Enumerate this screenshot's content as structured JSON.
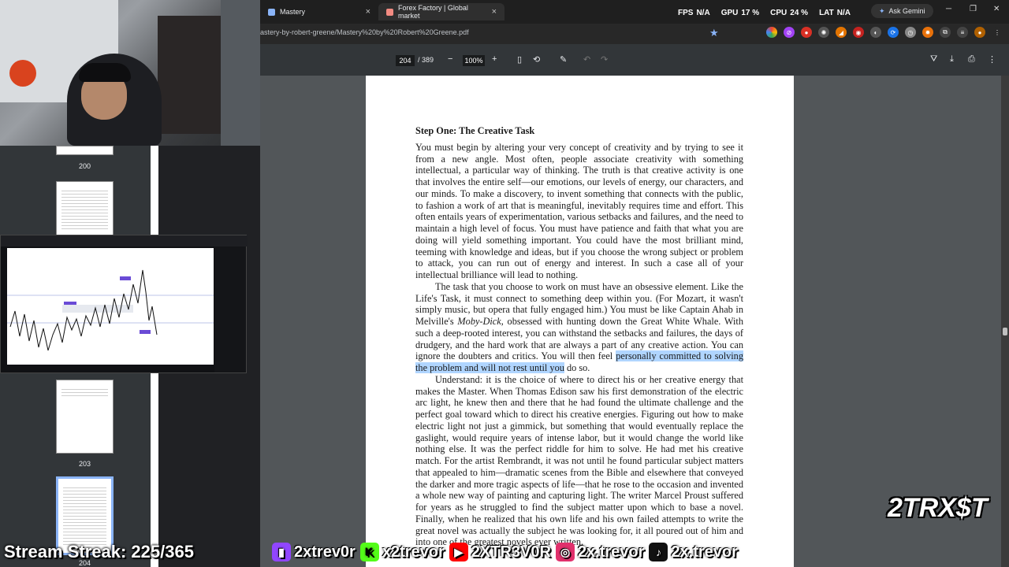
{
  "tabs": [
    {
      "label": "Mastery",
      "close": "×",
      "color": "#8ab4f8"
    },
    {
      "label": "Forex Factory | Global market",
      "close": "×",
      "color": "#f28b82"
    }
  ],
  "perf_stats": [
    {
      "label": "FPS",
      "value": "N/A"
    },
    {
      "label": "GPU",
      "value": "17 %"
    },
    {
      "label": "CPU",
      "value": "24 %"
    },
    {
      "label": "LAT",
      "value": "N/A"
    }
  ],
  "gemini_label": "Ask Gemini",
  "address_url": "astery-by-robert-greene/Mastery%20by%20Robert%20Greene.pdf",
  "pdf_toolbar": {
    "current_page": "204",
    "total_pages": "/ 389",
    "zoom": "100%"
  },
  "pdf_page": {
    "heading": "Step One: The Creative Task",
    "p1": "You must begin by altering your very concept of creativity and by trying to see it from a new angle. Most often, people associate creativity with something intellectual, a particular way of thinking. The truth is that creative activity is one that involves the entire self—our emotions, our levels of energy, our characters, and our minds. To make a discovery, to invent something that connects with the public, to fashion a work of art that is meaningful, inevitably requires time and effort. This often entails years of experimentation, various setbacks and failures, and the need to maintain a high level of focus. You must have patience and faith that what you are doing will yield something important. You could have the most brilliant mind, teeming with knowledge and ideas, but if you choose the wrong subject or problem to attack, you can run out of energy and interest. In such a case all of your intellectual brilliance will lead to nothing.",
    "p2_start": "The task that you choose to work on must have an obsessive element. Like the Life's Task, it must connect to something deep within you. (For Mozart, it wasn't simply music, but opera that fully engaged him.) You must be like Captain Ahab in Melville's ",
    "p2_italic": "Moby-Dick",
    "p2_mid": ", obsessed with hunting down the Great White Whale. With such a deep-rooted interest, you can withstand the setbacks and failures, the days of drudgery, and the hard work that are always a part of any creative action. You can ignore the doubters and critics. You will then feel ",
    "p2_highlight": "personally committed to solving the problem and will not rest until you",
    "p2_end": " do so.",
    "p3": "Understand: it is the choice of where to direct his or her creative energy that makes the Master. When Thomas Edison saw his first demonstration of the electric arc light, he knew then and there that he had found the ultimate challenge and the perfect goal toward which to direct his creative energies. Figuring out how to make electric light not just a gimmick, but something that would eventually replace the gaslight, would require years of intense labor, but it would change the world like nothing else. It was the perfect riddle for him to solve. He had met his creative match. For the artist Rembrandt, it was not until he found particular subject matters that appealed to him—dramatic scenes from the Bible and elsewhere that conveyed the darker and more tragic aspects of life—that he rose to the occasion and invented a whole new way of painting and capturing light. The writer Marcel Proust suffered for years as he struggled to find the subject matter upon which to base a novel. Finally, when he realized that his own life and his own failed attempts to write the great novel was actually the subject he was looking for, it all poured out of him and into one of the greatest novels ever written."
  },
  "thumbnails": [
    {
      "label": "200"
    },
    {
      "label": "203"
    },
    {
      "label": "204"
    }
  ],
  "overlay": {
    "streak": "Stream Streak: 225/365",
    "brand": "2TRX$T",
    "socials": [
      {
        "icon": "twitch-icon",
        "glyph": "▮",
        "color": "#9146ff",
        "handle": "2xtrev0r"
      },
      {
        "icon": "kick-icon",
        "glyph": "K",
        "color": "#53fc18",
        "handle": "x2trevor"
      },
      {
        "icon": "youtube-icon",
        "glyph": "▶",
        "color": "#ff0000",
        "handle": "2XTR3V0R"
      },
      {
        "icon": "instagram-icon",
        "glyph": "◎",
        "color": "#e1306c",
        "handle": "2x.trevor"
      },
      {
        "icon": "tiktok-icon",
        "glyph": "♪",
        "color": "#111111",
        "handle": "2x.trevor"
      }
    ]
  }
}
